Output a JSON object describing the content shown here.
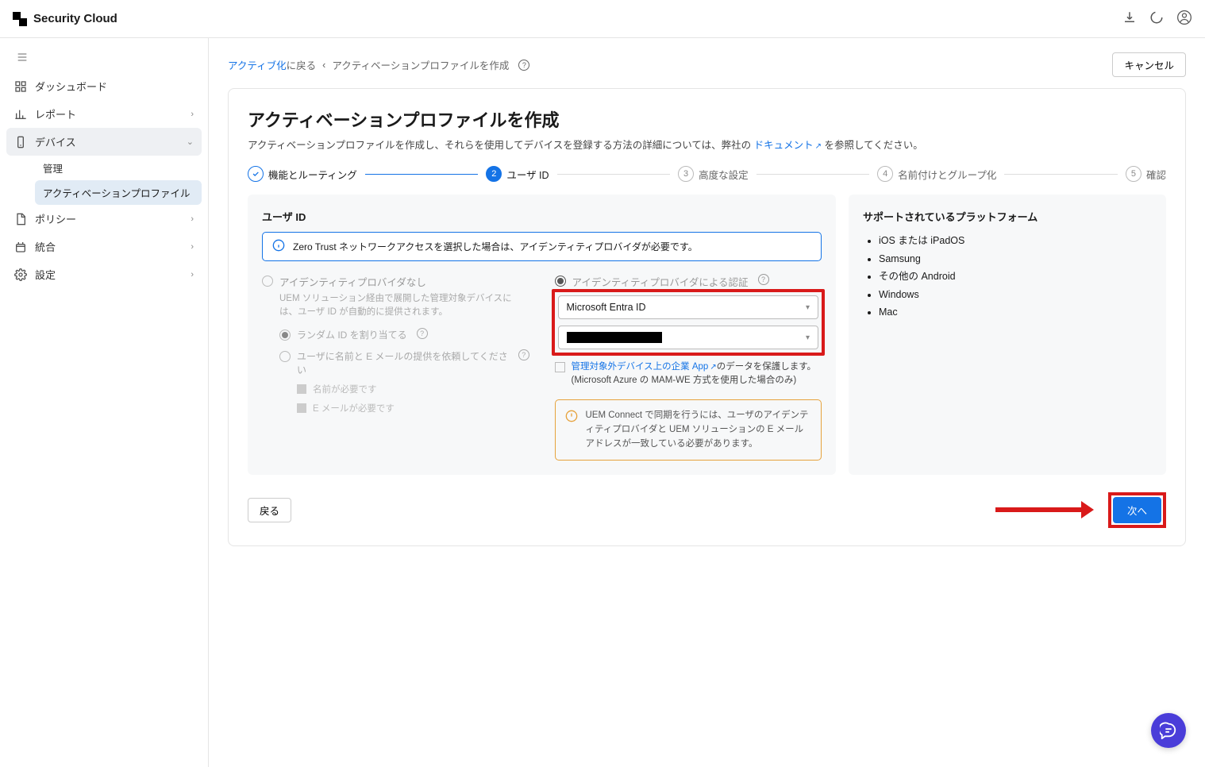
{
  "app": {
    "title": "Security Cloud"
  },
  "header_actions": {
    "download": "download-icon",
    "loading": "loading-icon",
    "user": "user-icon"
  },
  "sidebar": {
    "items": [
      {
        "label": "ダッシュボード",
        "icon": "dashboard-icon"
      },
      {
        "label": "レポート",
        "icon": "report-icon",
        "expandable": true
      },
      {
        "label": "デバイス",
        "icon": "device-icon",
        "expandable": true,
        "active": true
      },
      {
        "label": "ポリシー",
        "icon": "policy-icon",
        "expandable": true
      },
      {
        "label": "統合",
        "icon": "integration-icon",
        "expandable": true
      },
      {
        "label": "設定",
        "icon": "settings-icon",
        "expandable": true
      }
    ],
    "device_sub": [
      {
        "label": "管理"
      },
      {
        "label": "アクティベーションプロファイル",
        "active": true
      }
    ]
  },
  "breadcrumb": {
    "back_link": "アクティブ化",
    "back_suffix": "に戻る",
    "sep": "‹",
    "current": "アクティベーションプロファイルを作成"
  },
  "cancel_label": "キャンセル",
  "page": {
    "title": "アクティベーションプロファイルを作成",
    "subtitle_pre": "アクティベーションプロファイルを作成し、それらを使用してデバイスを登録する方法の詳細については、弊社の",
    "subtitle_link": "ドキュメント",
    "subtitle_post": "を参照してください。"
  },
  "stepper": [
    {
      "num": "✓",
      "label": "機能とルーティング",
      "state": "done"
    },
    {
      "num": "2",
      "label": "ユーザ ID",
      "state": "active"
    },
    {
      "num": "3",
      "label": "高度な設定",
      "state": "pending"
    },
    {
      "num": "4",
      "label": "名前付けとグループ化",
      "state": "pending"
    },
    {
      "num": "5",
      "label": "確認",
      "state": "pending"
    }
  ],
  "form": {
    "section_title": "ユーザ ID",
    "info_banner": "Zero Trust ネットワークアクセスを選択した場合は、アイデンティティプロバイダが必要です。",
    "left_radio": {
      "label": "アイデンティティプロバイダなし",
      "desc": "UEM ソリューション経由で展開した管理対象デバイスには、ユーザ ID が自動的に提供されます。",
      "sub_random": "ランダム ID を割り当てる",
      "sub_ask": "ユーザに名前と E メールの提供を依頼してください",
      "check_name": "名前が必要です",
      "check_email": "E メールが必要です"
    },
    "right_radio": {
      "label": "アイデンティティプロバイダによる認証",
      "select_idp": "Microsoft Entra ID",
      "select_tenant_redacted": true,
      "checkbox_text_link": "管理対象外デバイス上の企業 App",
      "checkbox_text_rest": "のデータを保護します。(Microsoft Azure の MAM-WE 方式を使用した場合のみ)",
      "warn": "UEM Connect で同期を行うには、ユーザのアイデンティティプロバイダと UEM ソリューションの E メールアドレスが一致している必要があります。"
    }
  },
  "platforms": {
    "title": "サポートされているプラットフォーム",
    "items": [
      "iOS または iPadOS",
      "Samsung",
      "その他の Android",
      "Windows",
      "Mac"
    ]
  },
  "footer": {
    "back": "戻る",
    "next": "次へ"
  }
}
